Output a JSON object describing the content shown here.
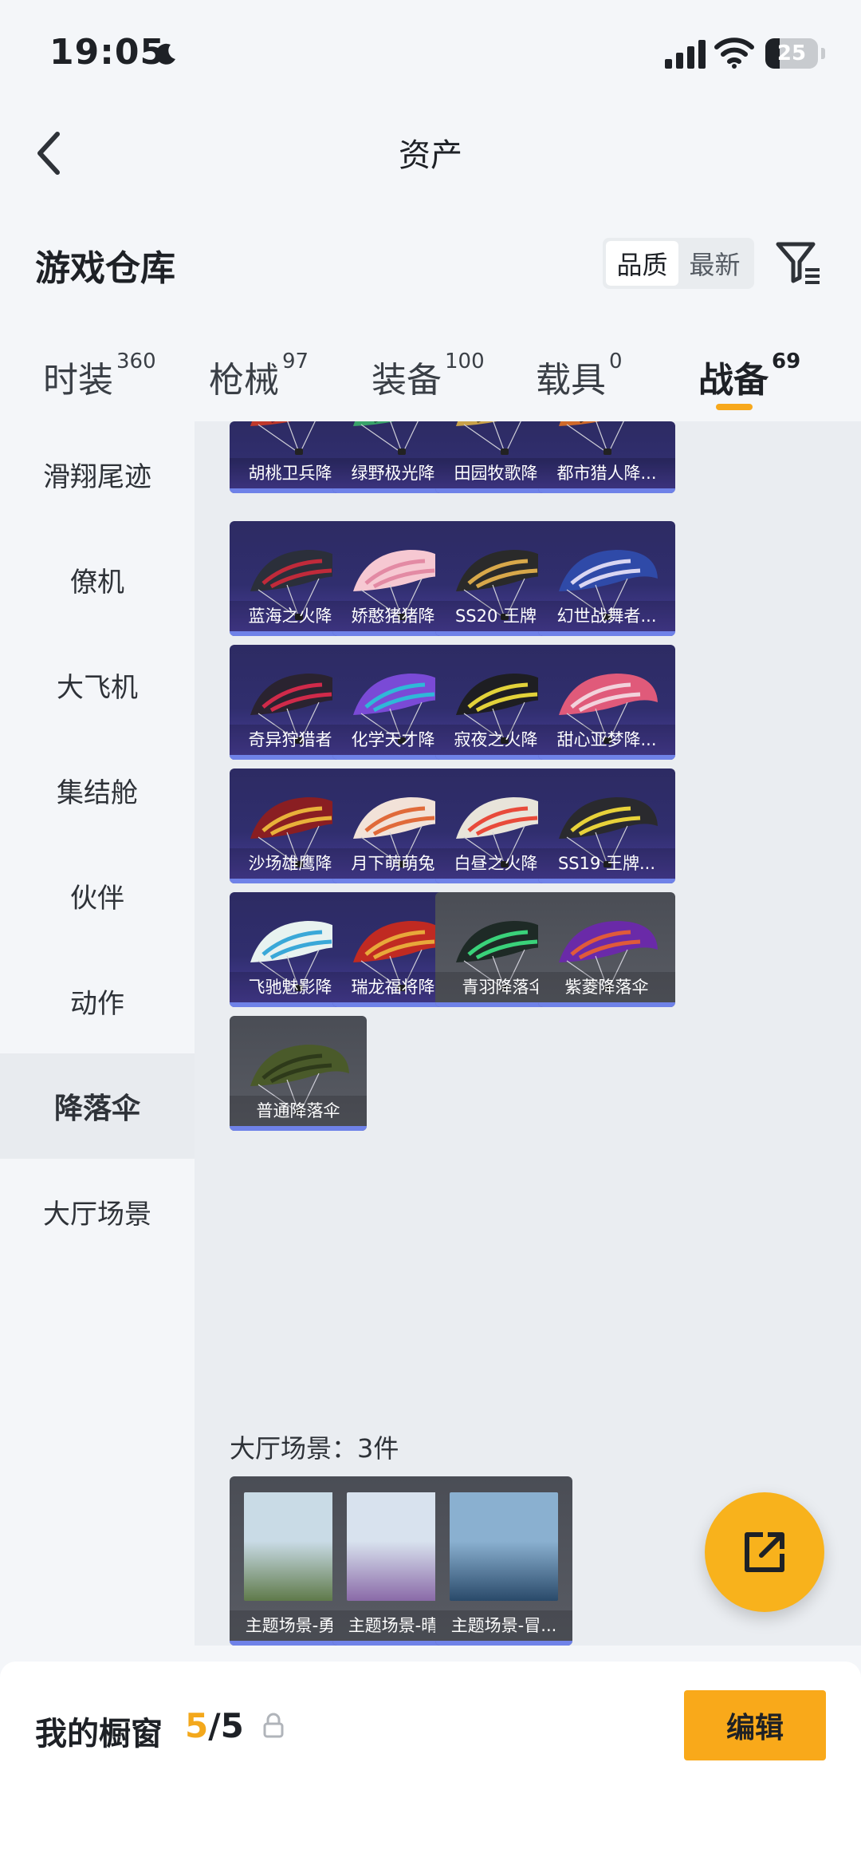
{
  "status_bar": {
    "time": "19:05",
    "battery": "25"
  },
  "header": {
    "title": "资产"
  },
  "section": {
    "title": "游戏仓库"
  },
  "sort": {
    "options": [
      "品质",
      "最新"
    ],
    "active": "品质"
  },
  "tabs": [
    {
      "label": "时装",
      "count": "360"
    },
    {
      "label": "枪械",
      "count": "97"
    },
    {
      "label": "装备",
      "count": "100"
    },
    {
      "label": "载具",
      "count": "0"
    },
    {
      "label": "战备",
      "count": "69"
    }
  ],
  "sidenav": {
    "items": [
      "滑翔尾迹",
      "僚机",
      "大飞机",
      "集结舱",
      "伙伴",
      "动作",
      "降落伞",
      "大厅场景"
    ],
    "active": "降落伞"
  },
  "parachutes": [
    {
      "label": "胡桃卫兵降...",
      "style": "purple",
      "colors": [
        "#c0392b",
        "#7a1d2e"
      ]
    },
    {
      "label": "绿野极光降...",
      "style": "purple",
      "colors": [
        "#3aa36a",
        "#1f5a40"
      ]
    },
    {
      "label": "田园牧歌降...",
      "style": "purple",
      "colors": [
        "#c9a24a",
        "#6c5220"
      ]
    },
    {
      "label": "都市猎人降...",
      "style": "purple",
      "colors": [
        "#d06a2a",
        "#4a2a1a"
      ]
    },
    {
      "label": "蓝海之火降...",
      "style": "purple",
      "colors": [
        "#2b2f3a",
        "#c02a3a"
      ]
    },
    {
      "label": "娇憨猪猪降...",
      "style": "purple",
      "colors": [
        "#f6c8d2",
        "#e38aa4"
      ]
    },
    {
      "label": "SS20 王牌...",
      "style": "purple",
      "colors": [
        "#2a2a2a",
        "#d8a84a"
      ]
    },
    {
      "label": "幻世战舞者...",
      "style": "purple",
      "colors": [
        "#2f4aa8",
        "#d9d6f2"
      ]
    },
    {
      "label": "奇异狩猎者...",
      "style": "purple",
      "colors": [
        "#2a2330",
        "#d02a4a"
      ]
    },
    {
      "label": "化学天才降...",
      "style": "purple",
      "colors": [
        "#7a4ad6",
        "#2fb8d8"
      ]
    },
    {
      "label": "寂夜之火降...",
      "style": "purple",
      "colors": [
        "#1e1e22",
        "#e2d23a"
      ]
    },
    {
      "label": "甜心亚梦降...",
      "style": "purple",
      "colors": [
        "#e05a7a",
        "#f2d2dc"
      ]
    },
    {
      "label": "沙场雄鹰降...",
      "style": "purple",
      "colors": [
        "#8a1e22",
        "#e8b23a"
      ]
    },
    {
      "label": "月下萌萌兔...",
      "style": "purple",
      "colors": [
        "#f2e2d8",
        "#e06a3a"
      ]
    },
    {
      "label": "白昼之火降...",
      "style": "purple",
      "colors": [
        "#e8e4da",
        "#e84a3a"
      ]
    },
    {
      "label": "SS19 王牌...",
      "style": "purple",
      "colors": [
        "#2a2a2e",
        "#e8d23a"
      ]
    },
    {
      "label": "飞驰魅影降...",
      "style": "purple",
      "colors": [
        "#e8f2f0",
        "#3aa8d8"
      ]
    },
    {
      "label": "瑞龙福将降...",
      "style": "purple",
      "colors": [
        "#c02a22",
        "#e8a83a"
      ]
    },
    {
      "label": "青羽降落伞",
      "style": "gray",
      "colors": [
        "#1e2a26",
        "#3ad27a"
      ]
    },
    {
      "label": "紫菱降落伞",
      "style": "gray",
      "colors": [
        "#6a2aa8",
        "#e05a3a"
      ]
    },
    {
      "label": "普通降落伞",
      "style": "gray",
      "colors": [
        "#4a5a2a",
        "#2e3a1a"
      ]
    }
  ],
  "lobby": {
    "title": "大厅场景：3件",
    "items": [
      {
        "label": "主题场景-勇...",
        "sky": "#c9dbe6",
        "land": "#5f7a4a"
      },
      {
        "label": "主题场景-晴...",
        "sky": "#d8e2ee",
        "land": "#8a6aa8"
      },
      {
        "label": "主题场景-冒...",
        "sky": "#8ab0d0",
        "land": "#2a4a6a"
      }
    ]
  },
  "bottom": {
    "label": "我的橱窗",
    "current": "5",
    "total": "/5",
    "edit": "编辑"
  },
  "theme": {
    "accent": "#f9a91a",
    "card_purple": "#2d2b63",
    "card_bar": "#6f82e8"
  }
}
